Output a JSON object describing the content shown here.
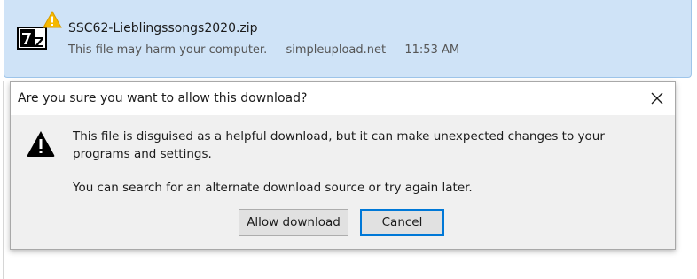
{
  "download": {
    "file_name": "SSC62-Lieblingssongs2020.zip",
    "status": "This file may harm your computer. — simpleupload.net — 11:53 AM",
    "file_icon": "7z-archive-icon",
    "badge_icon": "warning-icon",
    "badge_color": "#f5b800"
  },
  "dialog": {
    "title": "Are you sure you want to allow this download?",
    "close_icon": "close-icon",
    "alert_icon": "alert-triangle-icon",
    "message_primary": "This file is disguised as a helpful download, but it can make unexpected changes to your programs and settings.",
    "message_secondary": "You can search for an alternate download source or try again later.",
    "allow_button": "Allow download",
    "cancel_button": "Cancel",
    "focus_color": "#0078d7"
  }
}
